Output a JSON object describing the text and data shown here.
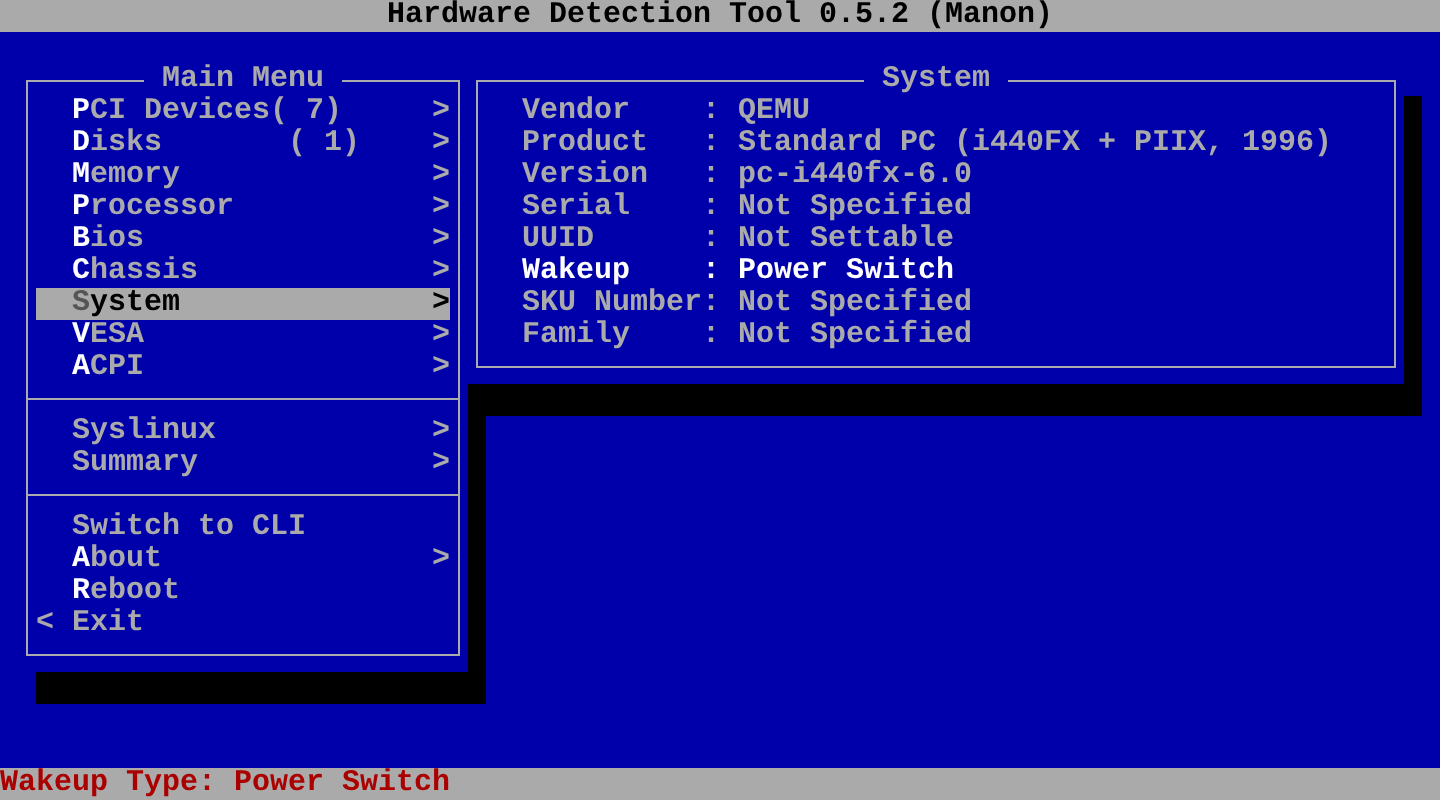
{
  "title_bar": {
    "title": "Hardware Detection Tool 0.5.2 (Manon)"
  },
  "main_menu": {
    "title": "Main Menu",
    "sections": [
      [
        {
          "label": "**P**CI Devices( 7)",
          "kind": "submenu",
          "arrow": ">",
          "selected": false
        },
        {
          "label": "**D**isks       ( 1)",
          "kind": "submenu",
          "arrow": ">",
          "selected": false
        },
        {
          "label": "**M**emory",
          "kind": "submenu",
          "arrow": ">",
          "selected": false
        },
        {
          "label": "**P**rocessor",
          "kind": "submenu",
          "arrow": ">",
          "selected": false
        },
        {
          "label": "**B**ios",
          "kind": "submenu",
          "arrow": ">",
          "selected": false
        },
        {
          "label": "**C**hassis",
          "kind": "submenu",
          "arrow": ">",
          "selected": false
        },
        {
          "label": "**S**ystem",
          "kind": "submenu",
          "arrow": ">",
          "selected": true
        },
        {
          "label": "**V**ESA",
          "kind": "submenu",
          "arrow": ">",
          "selected": false
        },
        {
          "label": "**A**CPI",
          "kind": "submenu",
          "arrow": ">",
          "selected": false
        }
      ],
      [
        {
          "label": "Syslinux",
          "kind": "submenu",
          "arrow": ">",
          "selected": false
        },
        {
          "label": "Summary",
          "kind": "submenu",
          "arrow": ">",
          "selected": false
        }
      ],
      [
        {
          "label": "Switch to CLI",
          "kind": "action",
          "selected": false
        },
        {
          "label": "**A**bout",
          "kind": "submenu",
          "arrow": ">",
          "selected": false
        },
        {
          "label": "**R**eboot",
          "kind": "action",
          "selected": false
        },
        {
          "label": "Exit",
          "kind": "back",
          "arrow": "<",
          "selected": false
        }
      ]
    ]
  },
  "system_panel": {
    "title": "System",
    "rows": [
      {
        "label": "Vendor",
        "value": ": QEMU",
        "highlighted": false
      },
      {
        "label": "Product",
        "value": ": Standard PC (i440FX + PIIX, 1996)",
        "highlighted": false
      },
      {
        "label": "Version",
        "value": ": pc-i440fx-6.0",
        "highlighted": false
      },
      {
        "label": "Serial",
        "value": ": Not Specified",
        "highlighted": false
      },
      {
        "label": "UUID",
        "value": ": Not Settable",
        "highlighted": false
      },
      {
        "label": "Wakeup",
        "value": ": Power Switch",
        "highlighted": true
      },
      {
        "label": "SKU Number",
        "value": ": Not Specified",
        "highlighted": false
      },
      {
        "label": "Family",
        "value": ": Not Specified",
        "highlighted": false
      }
    ]
  },
  "status_bar": {
    "text": "Wakeup Type: Power Switch"
  }
}
